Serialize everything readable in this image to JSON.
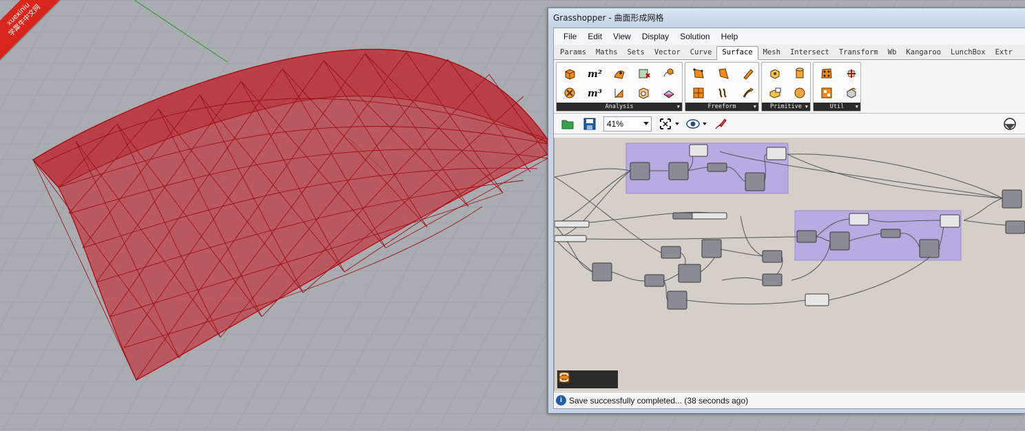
{
  "watermark": {
    "line1": "xuexiniu",
    "line2": "学犀牛中文网"
  },
  "window": {
    "title": "Grasshopper - 曲面形成网格"
  },
  "menu": [
    "File",
    "Edit",
    "View",
    "Display",
    "Solution",
    "Help"
  ],
  "tabs": [
    "Params",
    "Maths",
    "Sets",
    "Vector",
    "Curve",
    "Surface",
    "Mesh",
    "Intersect",
    "Transform",
    "Wb",
    "Kangaroo",
    "LunchBox",
    "Extr"
  ],
  "active_tab": "Surface",
  "ribbon": {
    "panels": [
      {
        "label": "Analysis",
        "icons": [
          "box-properties-icon",
          "area-icon",
          "volume-icon",
          "brep-closest-point-icon",
          "evaluate-surface-icon",
          "dimensions-icon",
          "is-planar-icon",
          "point-in-brep-icon",
          "surface-closest-point-icon",
          "deconstruct-brep-icon"
        ]
      },
      {
        "label": "Freeform",
        "icons": [
          "four-point-surface-icon",
          "surface-from-points-icon",
          "extrude-icon",
          "network-surface-icon",
          "loft-icon",
          "sweep-icon"
        ]
      },
      {
        "label": "Primitive",
        "icons": [
          "box-icon",
          "cylinder-icon",
          "bounding-box-icon",
          "sphere-icon"
        ]
      },
      {
        "label": "Util",
        "icons": [
          "divide-surface-icon",
          "surface-frames-icon",
          "isotrim-icon",
          "brep-join-icon"
        ]
      }
    ]
  },
  "toolbar": {
    "zoom": "41%"
  },
  "status": {
    "message": "Save successfully completed... (38 seconds ago)",
    "icon_glyph": "i"
  },
  "colors": {
    "mesh_red": "#c8141c",
    "group_purple": "#b2a4e6",
    "canvas_bg": "#d4d0c8",
    "viewport_bg": "#a9adb1"
  }
}
